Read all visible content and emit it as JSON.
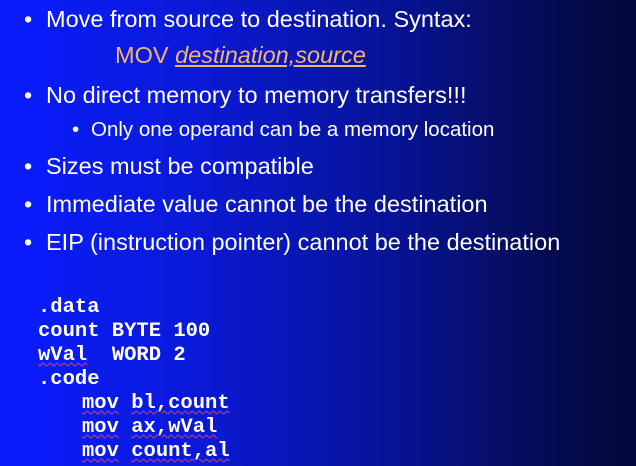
{
  "bullets": [
    "Move from source to destination. Syntax:",
    "No direct memory to memory transfers!!!",
    "Only one operand can be a memory location",
    "Sizes must be compatible",
    "Immediate value cannot be the destination",
    "EIP (instruction pointer) cannot be the destination"
  ],
  "syntax": {
    "keyword": "MOV",
    "operands": "destination,source"
  },
  "code": {
    "line1": ".data",
    "line2": "count BYTE 100",
    "line3_label": "wVal",
    "line3_rest": "  WORD 2",
    "line4": ".code",
    "line5_op": "mov",
    "line5_args": "bl,count",
    "line6_op": "mov",
    "line6_args": "ax,wVal",
    "line7_op": "mov",
    "line7_args": "count,al"
  },
  "colors": {
    "text": "#ffffff",
    "syntax": "#f2b66f",
    "spellcheck": "#ff3a3a"
  }
}
